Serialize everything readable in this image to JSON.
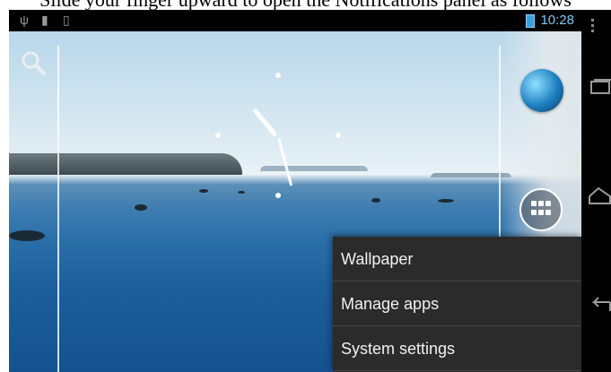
{
  "caption": {
    "text": "Slide your finger upward to open the Notifications panel as follows"
  },
  "status_bar": {
    "time": "10:28",
    "icons": [
      "usb-icon",
      "sd-card-icon",
      "vibrate-icon",
      "battery-icon"
    ]
  },
  "home": {
    "search_icon": "search-icon",
    "apps_icon": "all-apps-icon",
    "globe_icon": "browser-globe-icon"
  },
  "menu": {
    "items": [
      {
        "label": "Wallpaper"
      },
      {
        "label": "Manage apps"
      },
      {
        "label": "System settings"
      }
    ]
  },
  "navigation": {
    "icons": [
      "overflow-menu-icon",
      "recent-apps-icon",
      "home-icon",
      "back-icon"
    ]
  },
  "colors": {
    "status_time": "#7ec8f5",
    "menu_bg": "#2b2b2b",
    "menu_text": "#f2f2f2"
  }
}
